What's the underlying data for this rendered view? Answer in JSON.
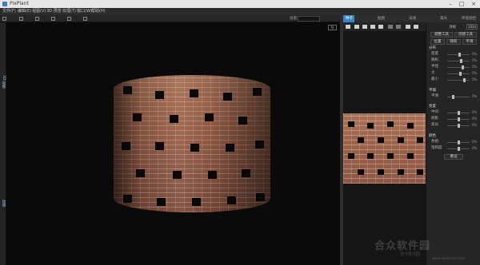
{
  "window": {
    "title": "PixPlant"
  },
  "menu": [
    "文件(F)",
    "编辑(E)",
    "视图(V)",
    "3D 预览",
    "纹理(T)",
    "窗口(W)",
    "帮助(H)"
  ],
  "toolbar": {
    "zoom_label": "质量"
  },
  "left_tabs": {
    "top": "3D 视图",
    "bottom": "纹理"
  },
  "viewport": {
    "corner_label": "fit"
  },
  "panel_tabs": [
    "种子",
    "",
    "贴图",
    "",
    "法线",
    "",
    "高光",
    "",
    "环境遮挡"
  ],
  "right_panel": {
    "size_label": "顶视",
    "size_value": "1024",
    "buttons": [
      "调整工具",
      "创建工具",
      "位置",
      "随机",
      "平滑"
    ],
    "sections": [
      {
        "title": "分布",
        "rows": [
          {
            "label": "密度",
            "value": "0%"
          },
          {
            "label": "随机",
            "value": "0%"
          },
          {
            "label": "半径",
            "value": "0%"
          },
          {
            "label": "大",
            "value": "0%"
          },
          {
            "label": "最小",
            "value": "0%"
          }
        ]
      },
      {
        "title": "平铺",
        "rows": [
          {
            "label": "平滑",
            "value": "0%"
          }
        ]
      },
      {
        "title": "亮度",
        "rows": [
          {
            "label": "中间",
            "value": "0%"
          },
          {
            "label": "阴影",
            "value": "0%"
          },
          {
            "label": "高光",
            "value": "0%"
          }
        ]
      },
      {
        "title": "颜色",
        "rows": [
          {
            "label": "色相",
            "value": "0%"
          },
          {
            "label": "饱和度",
            "value": "0%"
          }
        ]
      }
    ],
    "reset_label": "重设"
  },
  "watermark": {
    "main": "合众软件园",
    "sub": "当下软件园",
    "url": "www.downxia.com"
  },
  "colors": {
    "accent": "#3a84c9",
    "viewport_bg": "#0a0a0a",
    "brick": "#9b5f47"
  }
}
